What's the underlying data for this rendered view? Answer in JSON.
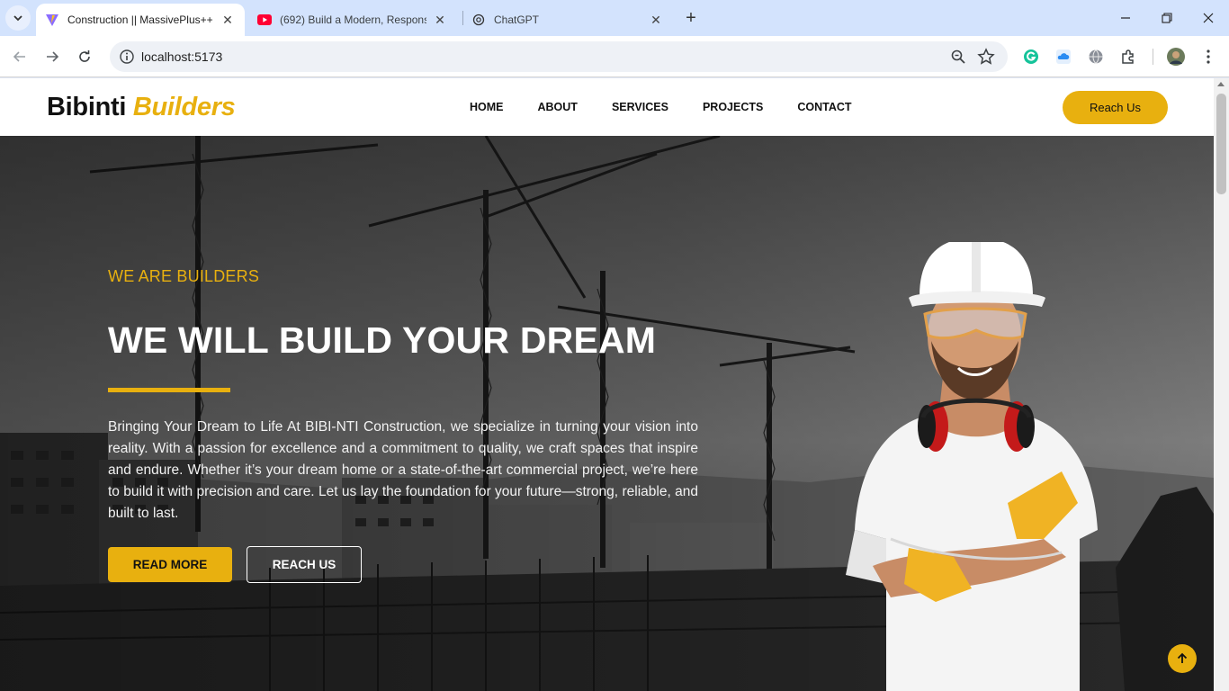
{
  "browser": {
    "tabs": [
      {
        "title": "Construction || MassivePlus++",
        "icon": "vite-icon",
        "active": true
      },
      {
        "title": "(692) Build a Modern, Responsi",
        "icon": "youtube-icon",
        "active": false
      },
      {
        "title": "ChatGPT",
        "icon": "chatgpt-icon",
        "active": false
      }
    ],
    "url": "localhost:5173"
  },
  "site": {
    "logo": {
      "main": "Bibinti",
      "accent": "Builders"
    },
    "nav": [
      "HOME",
      "ABOUT",
      "SERVICES",
      "PROJECTS",
      "CONTACT"
    ],
    "cta": "Reach Us",
    "hero": {
      "eyebrow": "WE ARE BUILDERS",
      "title": "WE WILL BUILD YOUR DREAM",
      "text": "Bringing Your Dream to Life At BIBI-NTI Construction, we specialize in turning your vision into reality. With a passion for excellence and a commitment to quality, we craft spaces that inspire and endure. Whether it’s your dream home or a state-of-the-art commercial project, we’re here to build it with precision and care. Let us lay the foundation for your future—strong, reliable, and built to last.",
      "read_more": "READ MORE",
      "reach_us": "REACH US"
    }
  },
  "colors": {
    "accent": "#e8b00f",
    "tabstrip": "#d3e3fd"
  }
}
